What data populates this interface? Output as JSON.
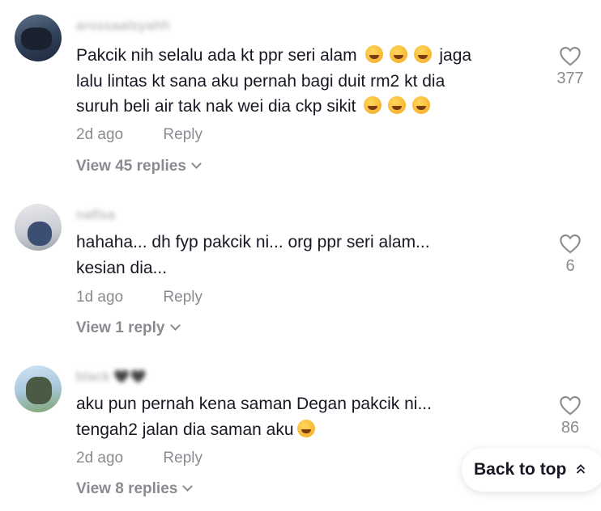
{
  "comments": [
    {
      "username": "arossaalsyahh",
      "text_line1_a": "Pakcik nih selalu ada kt ppr seri alam",
      "text_line1_b": "jaga",
      "text_line2": "lalu lintas kt sana aku pernah bagi duit rm2 kt dia",
      "text_line3": "suruh beli air tak nak wei dia ckp sikit",
      "age": "2d ago",
      "reply_label": "Reply",
      "view_replies": "View 45 replies",
      "likes": "377"
    },
    {
      "username": "naflsa",
      "text_line1": "hahaha... dh fyp pakcik ni... org ppr seri alam...",
      "text_line2": "kesian dia...",
      "age": "1d ago",
      "reply_label": "Reply",
      "view_replies": "View 1 reply",
      "likes": "6"
    },
    {
      "username": "black",
      "username_suffix": "🖤🖤",
      "text_line1": "aku pun pernah kena saman Degan pakcik ni...",
      "text_line2": "tengah2 jalan dia saman aku",
      "age": "2d ago",
      "reply_label": "Reply",
      "view_replies": "View 8 replies",
      "likes": "86"
    }
  ],
  "back_to_top": {
    "label": "Back to top",
    "icon": "double-chevron-up-icon"
  },
  "colors": {
    "primary_text": "#161823",
    "secondary_text": "#8a8b91",
    "heart_outline": "#8a8b91"
  }
}
